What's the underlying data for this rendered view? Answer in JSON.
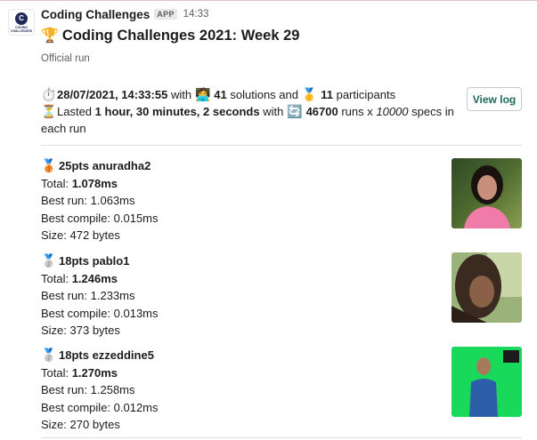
{
  "app": {
    "sender": "Coding Challenges",
    "badge": "APP",
    "time": "14:33",
    "logo_letter": "C",
    "logo_text": "CODING CHALLENGES"
  },
  "message": {
    "title": "Coding Challenges 2021: Week 29",
    "subtitle": "Official run",
    "summary": {
      "datetime": "28/07/2021, 14:33:55",
      "with": " with ",
      "solutions_count": "41",
      "solutions_label": " solutions and ",
      "participants_count": "11",
      "participants_label": " participants",
      "lasted_label": "Lasted ",
      "duration": "1 hour, 30 minutes, 2 seconds",
      "with2": " with ",
      "runs_count": "46700",
      "runs_label": " runs x ",
      "specs_count": "10000",
      "specs_label": " specs in each run"
    },
    "view_log_label": "View log"
  },
  "entries": [
    {
      "medal": "🥉",
      "name_line": "25pts anuradha2",
      "total_label": "Total: ",
      "total": "1.078ms",
      "best_run": "Best run: 1.063ms",
      "best_compile": "Best compile: 0.015ms",
      "size": "Size: 472 bytes"
    },
    {
      "medal": "🥈",
      "name_line": "18pts pablo1",
      "total_label": "Total: ",
      "total": "1.246ms",
      "best_run": "Best run: 1.233ms",
      "best_compile": "Best compile: 0.013ms",
      "size": "Size: 373 bytes"
    },
    {
      "medal": "🥈",
      "name_line": "18pts ezzeddine5",
      "total_label": "Total: ",
      "total": "1.270ms",
      "best_run": "Best run: 1.258ms",
      "best_compile": "Best compile: 0.012ms",
      "size": "Size: 270 bytes"
    }
  ],
  "colors": {
    "accent_link": "#1d6b5a",
    "muted_text": "#616061",
    "divider": "#dddddd"
  }
}
